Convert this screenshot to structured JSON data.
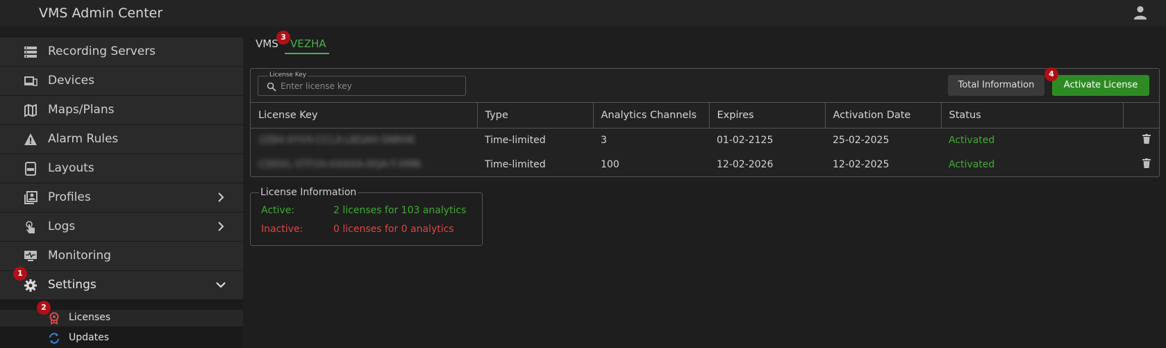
{
  "header": {
    "title": "VMS Admin Center",
    "user_icon": "user-icon"
  },
  "sidebar": {
    "items": [
      {
        "label": "Recording Servers",
        "icon": "server-icon"
      },
      {
        "label": "Devices",
        "icon": "devices-icon"
      },
      {
        "label": "Maps/Plans",
        "icon": "map-icon"
      },
      {
        "label": "Alarm Rules",
        "icon": "warning-icon"
      },
      {
        "label": "Layouts",
        "icon": "layout-icon"
      },
      {
        "label": "Profiles",
        "icon": "profile-icon",
        "expandable": true
      },
      {
        "label": "Logs",
        "icon": "touch-icon",
        "expandable": true
      },
      {
        "label": "Monitoring",
        "icon": "monitor-icon"
      },
      {
        "label": "Settings",
        "icon": "gear-icon",
        "expanded": true
      }
    ],
    "subitems": [
      {
        "label": "Licenses",
        "icon": "award-icon",
        "active": true
      },
      {
        "label": "Updates",
        "icon": "refresh-icon"
      }
    ]
  },
  "badges": [
    "1",
    "2",
    "3",
    "4"
  ],
  "tabs": [
    {
      "label": "VMS"
    },
    {
      "label": "VEZHA",
      "active": true
    }
  ],
  "search": {
    "legend": "License Key",
    "placeholder": "Enter license key",
    "value": ""
  },
  "buttons": {
    "total_info": "Total Information",
    "activate": "Activate License"
  },
  "table": {
    "columns": [
      "License Key",
      "Type",
      "Analytics Channels",
      "Expires",
      "Activation Date",
      "Status",
      ""
    ],
    "rows": [
      {
        "key": "2ZB4-6YVX-CCLX-L8GAH-SNRHK",
        "type": "Time-limited",
        "channels": "3",
        "expires": "01-02-2125",
        "activated": "25-02-2025",
        "status": "Activated"
      },
      {
        "key": "CDDVL-STFUV-AXAXA-DQA-T-XMN",
        "type": "Time-limited",
        "channels": "100",
        "expires": "12-02-2026",
        "activated": "12-02-2025",
        "status": "Activated"
      }
    ]
  },
  "license_info": {
    "legend": "License Information",
    "active_label": "Active:",
    "active_value": "2 licenses for 103 analytics",
    "inactive_label": "Inactive:",
    "inactive_value": "0 licenses for 0 analytics"
  },
  "colors": {
    "accent_green": "#3faa34",
    "button_green": "#2e8b24",
    "error_red": "#e04545",
    "badge_red": "#b10f16"
  }
}
